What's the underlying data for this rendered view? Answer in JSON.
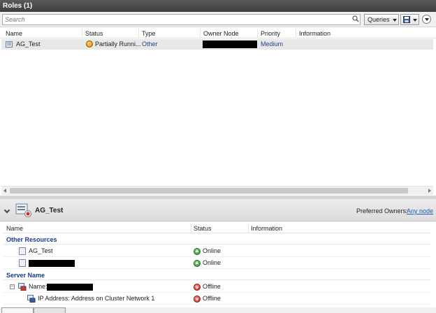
{
  "window": {
    "title": "Roles (1)"
  },
  "toolbar": {
    "search_placeholder": "Search",
    "queries_label": "Queries"
  },
  "roles_table": {
    "columns": [
      "Name",
      "Status",
      "Type",
      "Owner Node",
      "Priority",
      "Information"
    ],
    "rows": [
      {
        "name": "AG_Test",
        "status": "Partially Runni...",
        "type": "Other",
        "owner_node": "[redacted]",
        "priority": "Medium",
        "information": ""
      }
    ]
  },
  "detail": {
    "title": "AG_Test",
    "preferred_owners_label": "Preferred Owners:",
    "preferred_owners_link": "Any node",
    "columns": [
      "Name",
      "Status",
      "Information"
    ],
    "groups": [
      {
        "label": "Other Resources",
        "items": [
          {
            "name": "AG_Test",
            "status": "Online"
          },
          {
            "name": "[redacted]",
            "status": "Online"
          }
        ]
      },
      {
        "label": "Server Name",
        "items": [
          {
            "name": "Name: ",
            "status": "Offline",
            "redacted_suffix": true
          },
          {
            "name": "IP Address: Address on Cluster Network 1",
            "status": "Offline"
          }
        ]
      }
    ]
  },
  "colors": {
    "title_bar": "#3e3e3e",
    "selected_row": "#e8e8e8",
    "group_header": "#1a3a8a",
    "link": "#1a5fb4",
    "online": "#2e8b2e",
    "offline": "#c62020"
  }
}
